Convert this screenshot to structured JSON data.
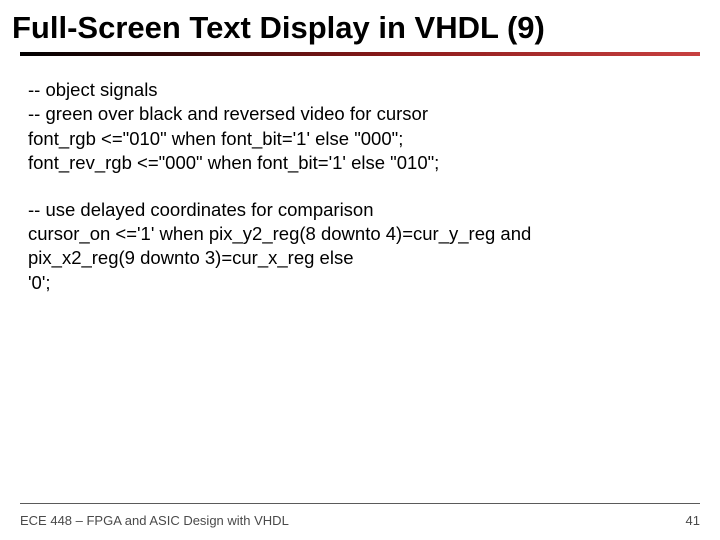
{
  "title": "Full-Screen Text Display in VHDL (9)",
  "code": {
    "l1": "-- object signals",
    "l2": "-- green over black and reversed video for cursor",
    "l3": "font_rgb <=\"010\" when font_bit='1' else \"000\";",
    "l4": "font_rev_rgb <=\"000\" when font_bit='1' else \"010\";",
    "l5": "-- use delayed coordinates for comparison",
    "l6": "cursor_on <='1' when pix_y2_reg(8 downto 4)=cur_y_reg and",
    "l7": "pix_x2_reg(9 downto 3)=cur_x_reg else",
    "l8": "'0';"
  },
  "footer": {
    "left": "ECE 448 – FPGA and ASIC Design with VHDL",
    "right": "41"
  }
}
